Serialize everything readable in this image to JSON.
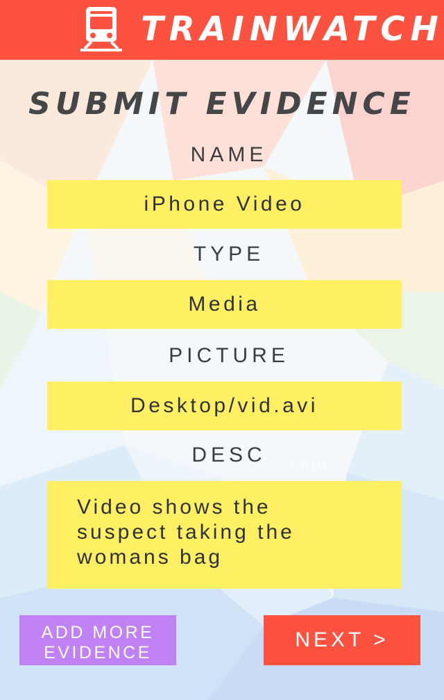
{
  "header": {
    "app_title": "TRAINWATCH!",
    "icon": "train-icon",
    "background_color": "#fe5240"
  },
  "page_title": "SUBMIT EVIDENCE",
  "form": {
    "name": {
      "label": "NAME",
      "value": "iPhone Video"
    },
    "type": {
      "label": "TYPE",
      "value": "Media"
    },
    "picture": {
      "label": "PICTURE",
      "value": "Desktop/vid.avi"
    },
    "desc": {
      "label": "DESC",
      "lines": [
        "Video shows the",
        "suspect taking the",
        "womans bag"
      ]
    },
    "field_color": "#ffef62"
  },
  "watermark": "CRIM",
  "buttons": {
    "add_more": {
      "lines": [
        "ADD MORE",
        "EVIDENCE"
      ],
      "color": "#c081f4"
    },
    "next": {
      "label": "NEXT >",
      "color": "#fe5240"
    }
  }
}
